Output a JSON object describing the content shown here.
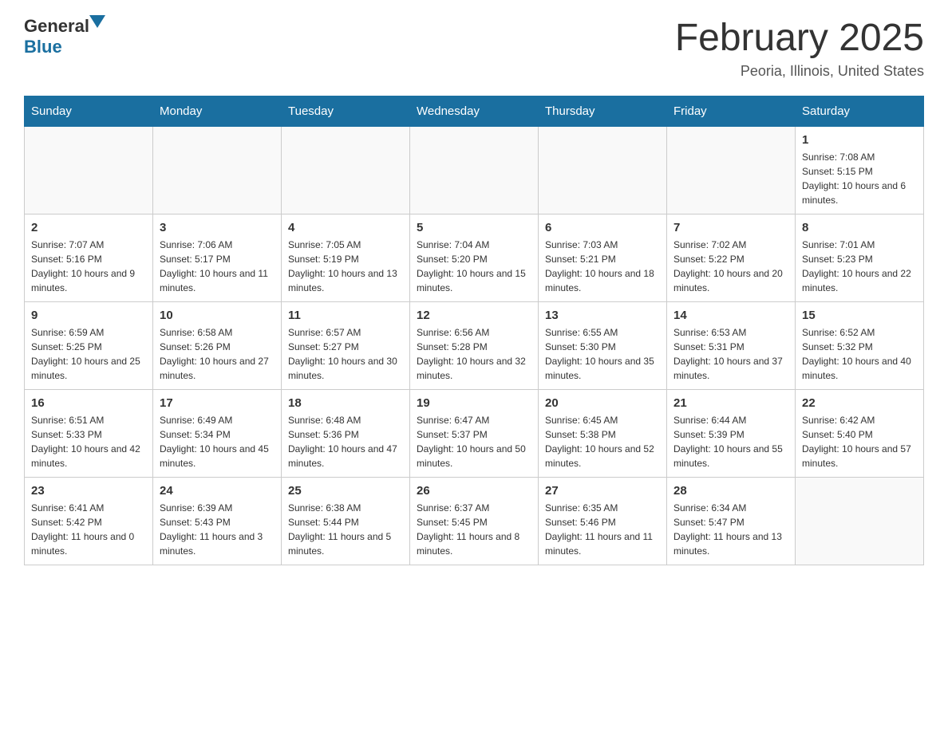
{
  "header": {
    "logo_general": "General",
    "logo_blue": "Blue",
    "title": "February 2025",
    "location": "Peoria, Illinois, United States"
  },
  "weekdays": [
    "Sunday",
    "Monday",
    "Tuesday",
    "Wednesday",
    "Thursday",
    "Friday",
    "Saturday"
  ],
  "weeks": [
    [
      {
        "day": "",
        "info": ""
      },
      {
        "day": "",
        "info": ""
      },
      {
        "day": "",
        "info": ""
      },
      {
        "day": "",
        "info": ""
      },
      {
        "day": "",
        "info": ""
      },
      {
        "day": "",
        "info": ""
      },
      {
        "day": "1",
        "info": "Sunrise: 7:08 AM\nSunset: 5:15 PM\nDaylight: 10 hours and 6 minutes."
      }
    ],
    [
      {
        "day": "2",
        "info": "Sunrise: 7:07 AM\nSunset: 5:16 PM\nDaylight: 10 hours and 9 minutes."
      },
      {
        "day": "3",
        "info": "Sunrise: 7:06 AM\nSunset: 5:17 PM\nDaylight: 10 hours and 11 minutes."
      },
      {
        "day": "4",
        "info": "Sunrise: 7:05 AM\nSunset: 5:19 PM\nDaylight: 10 hours and 13 minutes."
      },
      {
        "day": "5",
        "info": "Sunrise: 7:04 AM\nSunset: 5:20 PM\nDaylight: 10 hours and 15 minutes."
      },
      {
        "day": "6",
        "info": "Sunrise: 7:03 AM\nSunset: 5:21 PM\nDaylight: 10 hours and 18 minutes."
      },
      {
        "day": "7",
        "info": "Sunrise: 7:02 AM\nSunset: 5:22 PM\nDaylight: 10 hours and 20 minutes."
      },
      {
        "day": "8",
        "info": "Sunrise: 7:01 AM\nSunset: 5:23 PM\nDaylight: 10 hours and 22 minutes."
      }
    ],
    [
      {
        "day": "9",
        "info": "Sunrise: 6:59 AM\nSunset: 5:25 PM\nDaylight: 10 hours and 25 minutes."
      },
      {
        "day": "10",
        "info": "Sunrise: 6:58 AM\nSunset: 5:26 PM\nDaylight: 10 hours and 27 minutes."
      },
      {
        "day": "11",
        "info": "Sunrise: 6:57 AM\nSunset: 5:27 PM\nDaylight: 10 hours and 30 minutes."
      },
      {
        "day": "12",
        "info": "Sunrise: 6:56 AM\nSunset: 5:28 PM\nDaylight: 10 hours and 32 minutes."
      },
      {
        "day": "13",
        "info": "Sunrise: 6:55 AM\nSunset: 5:30 PM\nDaylight: 10 hours and 35 minutes."
      },
      {
        "day": "14",
        "info": "Sunrise: 6:53 AM\nSunset: 5:31 PM\nDaylight: 10 hours and 37 minutes."
      },
      {
        "day": "15",
        "info": "Sunrise: 6:52 AM\nSunset: 5:32 PM\nDaylight: 10 hours and 40 minutes."
      }
    ],
    [
      {
        "day": "16",
        "info": "Sunrise: 6:51 AM\nSunset: 5:33 PM\nDaylight: 10 hours and 42 minutes."
      },
      {
        "day": "17",
        "info": "Sunrise: 6:49 AM\nSunset: 5:34 PM\nDaylight: 10 hours and 45 minutes."
      },
      {
        "day": "18",
        "info": "Sunrise: 6:48 AM\nSunset: 5:36 PM\nDaylight: 10 hours and 47 minutes."
      },
      {
        "day": "19",
        "info": "Sunrise: 6:47 AM\nSunset: 5:37 PM\nDaylight: 10 hours and 50 minutes."
      },
      {
        "day": "20",
        "info": "Sunrise: 6:45 AM\nSunset: 5:38 PM\nDaylight: 10 hours and 52 minutes."
      },
      {
        "day": "21",
        "info": "Sunrise: 6:44 AM\nSunset: 5:39 PM\nDaylight: 10 hours and 55 minutes."
      },
      {
        "day": "22",
        "info": "Sunrise: 6:42 AM\nSunset: 5:40 PM\nDaylight: 10 hours and 57 minutes."
      }
    ],
    [
      {
        "day": "23",
        "info": "Sunrise: 6:41 AM\nSunset: 5:42 PM\nDaylight: 11 hours and 0 minutes."
      },
      {
        "day": "24",
        "info": "Sunrise: 6:39 AM\nSunset: 5:43 PM\nDaylight: 11 hours and 3 minutes."
      },
      {
        "day": "25",
        "info": "Sunrise: 6:38 AM\nSunset: 5:44 PM\nDaylight: 11 hours and 5 minutes."
      },
      {
        "day": "26",
        "info": "Sunrise: 6:37 AM\nSunset: 5:45 PM\nDaylight: 11 hours and 8 minutes."
      },
      {
        "day": "27",
        "info": "Sunrise: 6:35 AM\nSunset: 5:46 PM\nDaylight: 11 hours and 11 minutes."
      },
      {
        "day": "28",
        "info": "Sunrise: 6:34 AM\nSunset: 5:47 PM\nDaylight: 11 hours and 13 minutes."
      },
      {
        "day": "",
        "info": ""
      }
    ]
  ]
}
